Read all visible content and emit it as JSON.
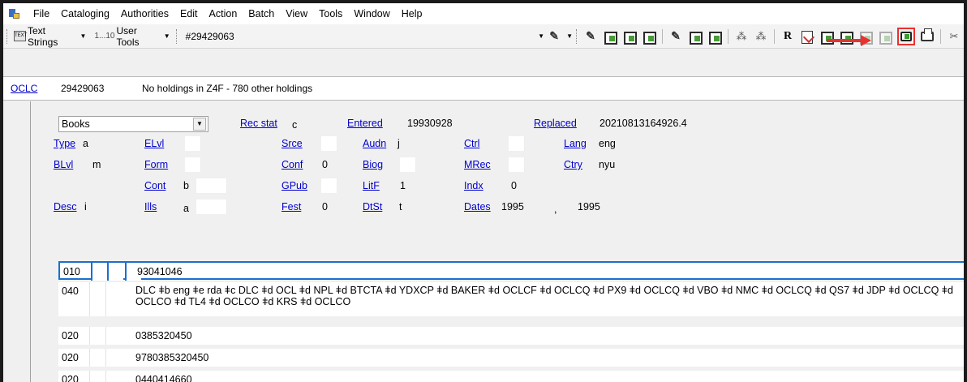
{
  "menu": [
    "File",
    "Cataloging",
    "Authorities",
    "Edit",
    "Action",
    "Batch",
    "View",
    "Tools",
    "Window",
    "Help"
  ],
  "toolbar": {
    "text_strings": "Text Strings",
    "user_tools": "User Tools",
    "ocn": "#29429063",
    "text_icon_label": "TEXT",
    "r_label": "R",
    "user_tools_icon": "1...10"
  },
  "header": {
    "oclc_label": "OCLC",
    "oclc_number": "29429063",
    "holdings": "No holdings in Z4F - 780 other holdings"
  },
  "fixed_field": {
    "type_select": "Books",
    "rec_stat": {
      "label": "Rec stat",
      "value": "c"
    },
    "entered": {
      "label": "Entered",
      "value": "19930928"
    },
    "replaced": {
      "label": "Replaced",
      "value": "20210813164926.4"
    },
    "type": {
      "label": "Type",
      "value": "a"
    },
    "elvl": {
      "label": "ELvl",
      "value": ""
    },
    "srce": {
      "label": "Srce",
      "value": ""
    },
    "audn": {
      "label": "Audn",
      "value": "j"
    },
    "ctrl": {
      "label": "Ctrl",
      "value": ""
    },
    "lang": {
      "label": "Lang",
      "value": "eng"
    },
    "blvl": {
      "label": "BLvl",
      "value": "m"
    },
    "form": {
      "label": "Form",
      "value": ""
    },
    "conf": {
      "label": "Conf",
      "value": "0"
    },
    "biog": {
      "label": "Biog",
      "value": ""
    },
    "mrec": {
      "label": "MRec",
      "value": ""
    },
    "ctry": {
      "label": "Ctry",
      "value": "nyu"
    },
    "cont": {
      "label": "Cont",
      "value": "b"
    },
    "gpub": {
      "label": "GPub",
      "value": ""
    },
    "litf": {
      "label": "LitF",
      "value": "1"
    },
    "indx": {
      "label": "Indx",
      "value": "0"
    },
    "desc": {
      "label": "Desc",
      "value": "i"
    },
    "ills": {
      "label": "Ills",
      "value": "a"
    },
    "fest": {
      "label": "Fest",
      "value": "0"
    },
    "dtst": {
      "label": "DtSt",
      "value": "t"
    },
    "dates": {
      "label": "Dates",
      "value1": "1995",
      "sep": ",",
      "value2": "1995"
    }
  },
  "fields": [
    {
      "tag": "010",
      "content": "93041046"
    },
    {
      "tag": "040",
      "content": "DLC ǂb eng ǂe rda ǂc DLC ǂd OCL ǂd NPL ǂd BTCTA ǂd YDXCP ǂd BAKER ǂd OCLCF ǂd OCLCQ ǂd PX9 ǂd OCLCQ ǂd VBO ǂd NMC ǂd OCLCQ ǂd QS7 ǂd JDP ǂd OCLCQ ǂd OCLCO ǂd TL4 ǂd OCLCO ǂd KRS ǂd OCLCO"
    },
    {
      "tag": "020",
      "content": "0385320450"
    },
    {
      "tag": "020",
      "content": "9780385320450"
    },
    {
      "tag": "020",
      "content": "0440414660"
    }
  ]
}
